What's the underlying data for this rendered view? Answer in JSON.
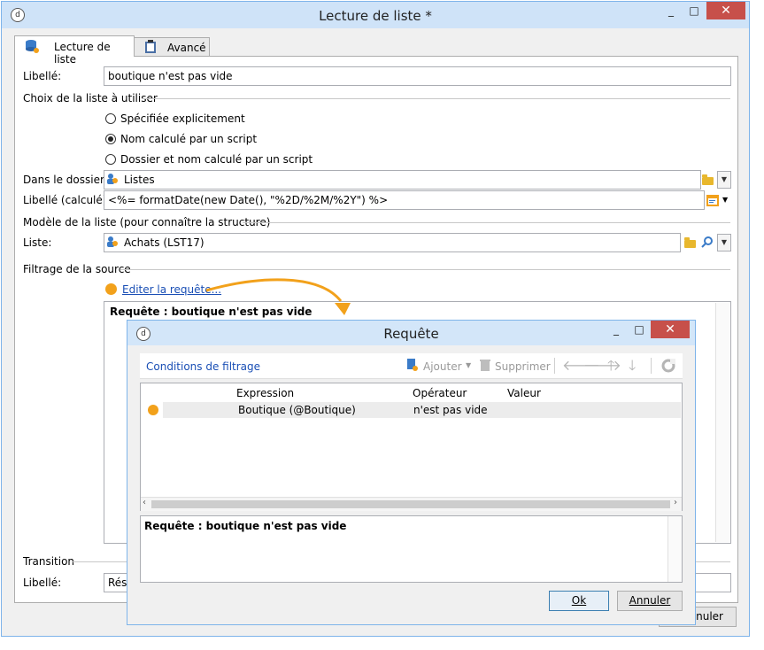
{
  "main_window": {
    "title": "Lecture de liste *",
    "controls": {
      "minimize": "_",
      "maximize": "□",
      "close": "✕"
    },
    "tabs": [
      {
        "label": "Lecture de liste"
      },
      {
        "label": "Avancé"
      }
    ],
    "libelle_label": "Libellé:",
    "libelle_value": "boutique n'est pas vide",
    "section_choix": "Choix de la liste à utiliser",
    "radios": [
      {
        "label": "Spécifiée explicitement",
        "checked": false
      },
      {
        "label": "Nom calculé par un script",
        "checked": true
      },
      {
        "label": "Dossier et nom calculé par un script",
        "checked": false
      }
    ],
    "dossier_label": "Dans le dossier:",
    "dossier_value": "Listes",
    "libelle_calc_label": "Libellé (calculé):",
    "libelle_calc_value": "<%= formatDate(new Date(), \"%2D/%2M/%2Y\") %>",
    "section_modele": "Modèle de la liste (pour connaître la structure)",
    "liste_label": "Liste:",
    "liste_value": "Achats (LST17)",
    "section_filtrage": "Filtrage de la source",
    "edit_link": "Editer la requête...",
    "requete_text": "Requête : boutique n'est pas vide",
    "section_transition": "Transition",
    "transition_libelle_label": "Libellé:",
    "transition_libelle_value": "Résu",
    "annuler_partial": "nuler"
  },
  "dialog": {
    "title": "Requête",
    "controls": {
      "minimize": "_",
      "maximize": "□",
      "close": "✕"
    },
    "conditions_label": "Conditions de filtrage",
    "toolbar": {
      "add": "Ajouter",
      "delete": "Supprimer"
    },
    "table": {
      "headers": [
        "Expression",
        "Opérateur",
        "Valeur"
      ],
      "rows": [
        {
          "expression": "Boutique (@Boutique)",
          "operator": "n'est pas vide",
          "value": ""
        }
      ]
    },
    "requete_text": "Requête : boutique n'est pas vide",
    "ok_label": "Ok",
    "cancel_label": "Annuler"
  },
  "colors": {
    "accent_orange": "#f2a11b",
    "title_bar": "#cfe3f8",
    "close_red": "#c7504a",
    "link_blue": "#1a4fb5"
  }
}
